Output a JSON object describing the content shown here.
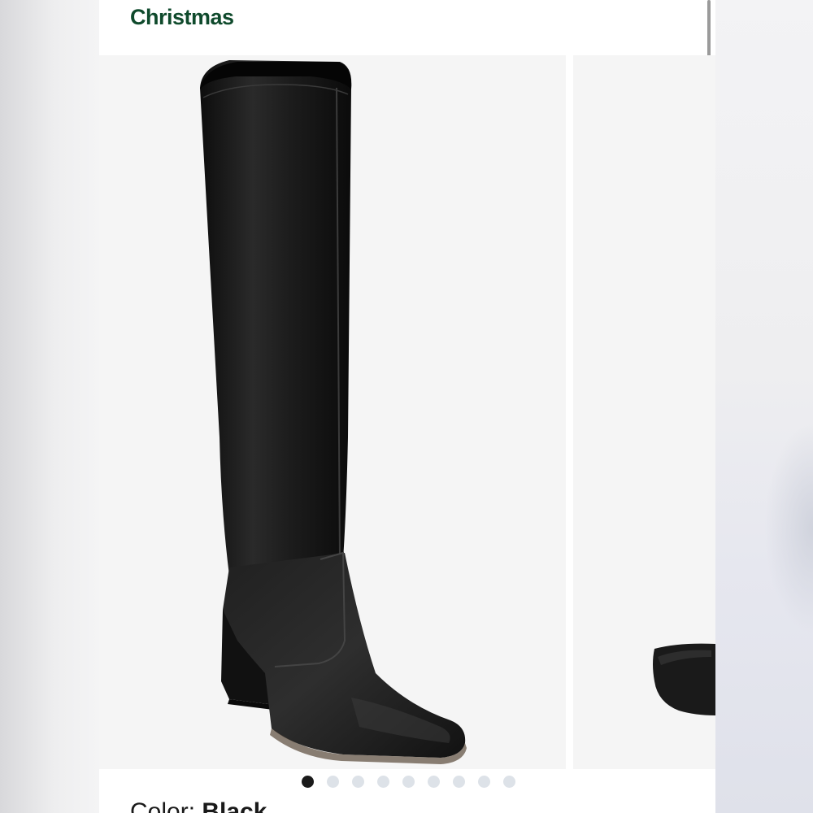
{
  "header": {
    "title": "Christmas"
  },
  "gallery": {
    "images": [
      {
        "icon": "boot-image",
        "description_label": ""
      },
      {
        "icon": "boot-image-partial",
        "description_label": ""
      }
    ],
    "dot_count": 9,
    "active_dot": 0
  },
  "product": {
    "color_label": "Color: ",
    "color_value": "Black"
  },
  "colors": {
    "brand": "#0f4a2c",
    "boot": "#1b1b1b",
    "slide_bg": "#f5f5f5",
    "dot_inactive": "#dde2e8",
    "dot_active": "#1a1a1a"
  }
}
